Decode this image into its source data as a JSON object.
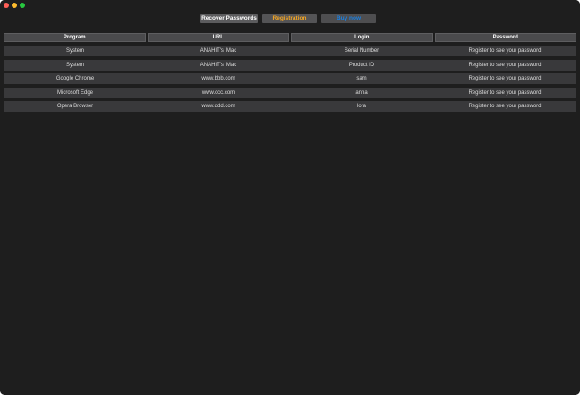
{
  "toolbar": {
    "recover_label": "Recover Passwords",
    "register_label": "Registration",
    "buy_label": "Buy now"
  },
  "table": {
    "headers": [
      "Program",
      "URL",
      "Login",
      "Password"
    ],
    "rows": [
      [
        "System",
        "ANAHIT's iMac",
        "Serial Number",
        "Register to see your password"
      ],
      [
        "System",
        "ANAHIT's iMac",
        "Product ID",
        "Register to see your password"
      ],
      [
        "Google Chrome",
        "www.bbb.com",
        "sam",
        "Register to see your password"
      ],
      [
        "Microsoft Edge",
        "www.ccc.com",
        "anna",
        "Register to see your password"
      ],
      [
        "Opera Browser",
        "www.ddd.com",
        "lora",
        "Register to see your password"
      ]
    ]
  },
  "colors": {
    "register_accent": "#f5a623",
    "buy_accent": "#1a7fe0",
    "background": "#1e1e1e"
  }
}
